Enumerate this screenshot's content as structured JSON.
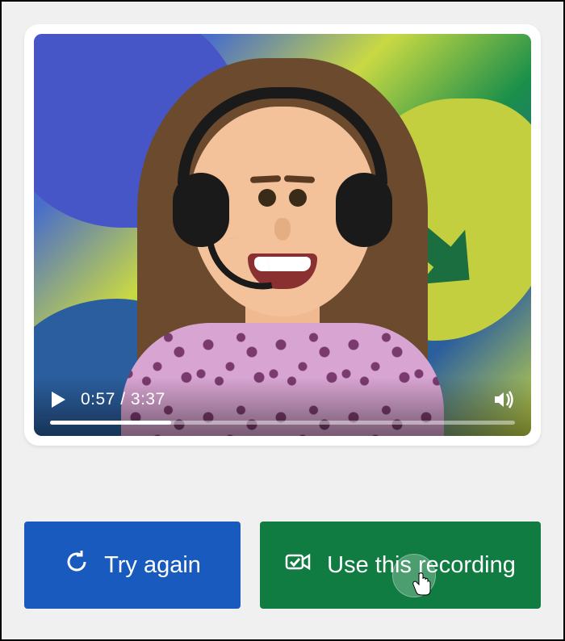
{
  "video": {
    "current_time": "0:57",
    "total_time": "3:37",
    "time_separator": " / ",
    "progress_percent": 26,
    "play_icon": "play-icon",
    "volume_icon": "volume-icon"
  },
  "buttons": {
    "try_again": {
      "label": "Try again",
      "icon": "retry-icon"
    },
    "use_recording": {
      "label": "Use this recording",
      "icon": "camera-check-icon"
    }
  },
  "colors": {
    "primary_blue": "#185abd",
    "primary_green": "#107c41"
  }
}
